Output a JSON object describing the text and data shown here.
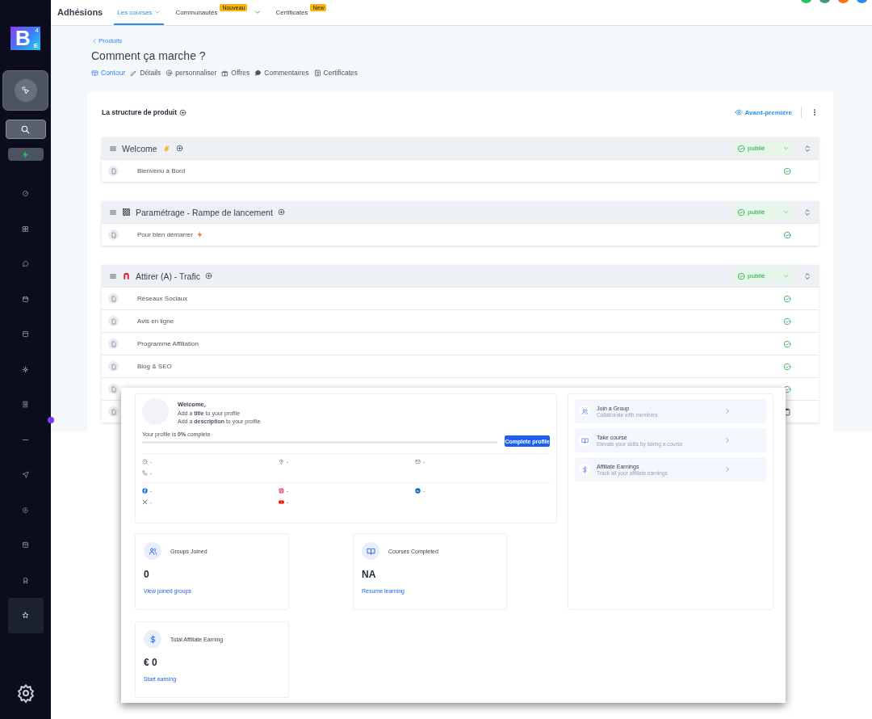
{
  "sidebar": {
    "logo": {
      "letter": "B",
      "sub": "E",
      "sup": "4"
    },
    "tools": [
      {
        "kind": "cursor"
      },
      {
        "kind": "search"
      },
      {
        "kind": "bolt"
      }
    ],
    "items": [
      {
        "kind": "gauge",
        "selected": false
      },
      {
        "kind": "grid",
        "selected": false
      },
      {
        "kind": "chat",
        "selected": false
      },
      {
        "kind": "calendar",
        "selected": false
      },
      {
        "kind": "archive",
        "selected": false
      },
      {
        "kind": "network",
        "selected": false
      },
      {
        "kind": "building",
        "selected": false
      },
      {
        "kind": "minus",
        "selected": false
      },
      {
        "kind": "send",
        "selected": false
      },
      {
        "kind": "refresh",
        "selected": false
      },
      {
        "kind": "inbox",
        "selected": false
      },
      {
        "kind": "award",
        "selected": false
      },
      {
        "kind": "star",
        "selected": true
      }
    ]
  },
  "topbar": {
    "app_name": "Adhésions",
    "tabs": [
      {
        "label": "Les courses",
        "selected": true,
        "dropdown": true
      },
      {
        "label": "Communautés",
        "badge": "Nouveau",
        "selected": false,
        "dropdown": true
      },
      {
        "label": "Certificates",
        "badge": "New",
        "selected": false,
        "dropdown": false
      }
    ],
    "avatars": [
      {
        "color": "#22c55e"
      },
      {
        "color": "#3f9b78"
      },
      {
        "color": "#f97316"
      },
      {
        "color": "#2b8cf0"
      }
    ]
  },
  "breadcrumb": "Produits",
  "title": "Comment ça marche ?",
  "subtabs": [
    {
      "label": "Contour",
      "kind": "table",
      "selected": true
    },
    {
      "label": "Détails",
      "kind": "pencil",
      "selected": false
    },
    {
      "label": "personnaliser",
      "kind": "at",
      "selected": false
    },
    {
      "label": "Offres",
      "kind": "gift",
      "selected": false
    },
    {
      "label": "Commentaires",
      "kind": "comment",
      "selected": false
    },
    {
      "label": "Certificates",
      "kind": "certificate",
      "selected": false
    }
  ],
  "structure": {
    "title": "La structure de produit",
    "preview": "Avant-première",
    "sections": [
      {
        "title": "Welcome",
        "icon": {
          "kind": "hand"
        },
        "status": "publié",
        "items": [
          {
            "title": "Bienvenu à Bord",
            "kind": "check",
            "bolt": false
          }
        ]
      },
      {
        "title": "Paramétrage - Rampe de lancement",
        "icon": {
          "kind": "checker"
        },
        "status": "publié",
        "items": [
          {
            "title": "Pour bien démarrer",
            "kind": "check",
            "bolt": true
          }
        ]
      },
      {
        "title": "Attirer (A) - Trafic",
        "icon": {
          "kind": "magnet"
        },
        "status": "publié",
        "items": [
          {
            "title": "Réseaux Sociaux",
            "kind": "check",
            "bolt": false
          },
          {
            "title": "Avis en ligne",
            "kind": "check",
            "bolt": false
          },
          {
            "title": "Programme Affiliation",
            "kind": "check",
            "bolt": false
          },
          {
            "title": "Blog & SEO",
            "kind": "check",
            "bolt": false
          },
          {
            "kind": "check",
            "bolt": false
          },
          {
            "kind": "clipboard",
            "bolt": false
          }
        ]
      }
    ]
  },
  "overlay": {
    "profile": {
      "greeting": "Welcome,",
      "lines": [
        "Add a **title** to your profile",
        "Add a **description** to your profile"
      ],
      "progress_text": "Your profile is **0%** complete",
      "level": 0,
      "button": "Complete profile",
      "contacts": [
        {
          "kind": "clock",
          "value": "-"
        },
        {
          "kind": "pin",
          "value": "-"
        },
        {
          "kind": "mail",
          "value": "-"
        },
        {
          "kind": "phone",
          "value": "-"
        }
      ],
      "socials": [
        {
          "kind": "facebook",
          "value": "-"
        },
        {
          "kind": "instagram",
          "value": "-"
        },
        {
          "kind": "linkedin",
          "value": "-"
        },
        {
          "kind": "x",
          "value": "-"
        },
        {
          "kind": "youtube",
          "value": "-"
        }
      ]
    },
    "stats": [
      {
        "kind": "group",
        "label": "Groups Joined",
        "value": "0",
        "link": "View joined groups"
      },
      {
        "kind": "book",
        "label": "Courses Completed",
        "value": "NA",
        "link": "Resume learning"
      },
      {
        "kind": "dollar",
        "label": "Total Affiliate Earning",
        "value": "€ 0",
        "link": "Start earning"
      }
    ],
    "actions": [
      {
        "kind": "group",
        "title": "Join a Group",
        "subtitle": "Collaborate with members"
      },
      {
        "kind": "book",
        "title": "Take course",
        "subtitle": "Elevate your skills by taking a course"
      },
      {
        "kind": "dollar",
        "title": "Affiliate Earnings",
        "subtitle": "Track all your affiliate earnings"
      }
    ]
  }
}
